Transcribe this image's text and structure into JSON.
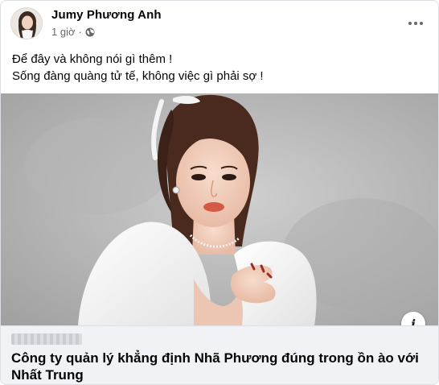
{
  "post": {
    "author_name": "Jumy Phương Anh",
    "timestamp": "1 giờ",
    "separator": "·",
    "privacy_icon": "globe-icon",
    "options_icon": "more-horizontal-icon",
    "text_lines": [
      "Để đây và không nói gì thêm !",
      "Sống đàng quàng tử tế, không việc gì phải sợ !"
    ]
  },
  "link_preview": {
    "info_glyph": "i",
    "title": "Công ty quản lý khẳng định Nhã Phương đúng trong ồn ào với Nhất Trung"
  },
  "colors": {
    "text_primary": "#050505",
    "text_secondary": "#65676b",
    "preview_bg": "#f0f2f5",
    "border": "#dcdfe4"
  }
}
